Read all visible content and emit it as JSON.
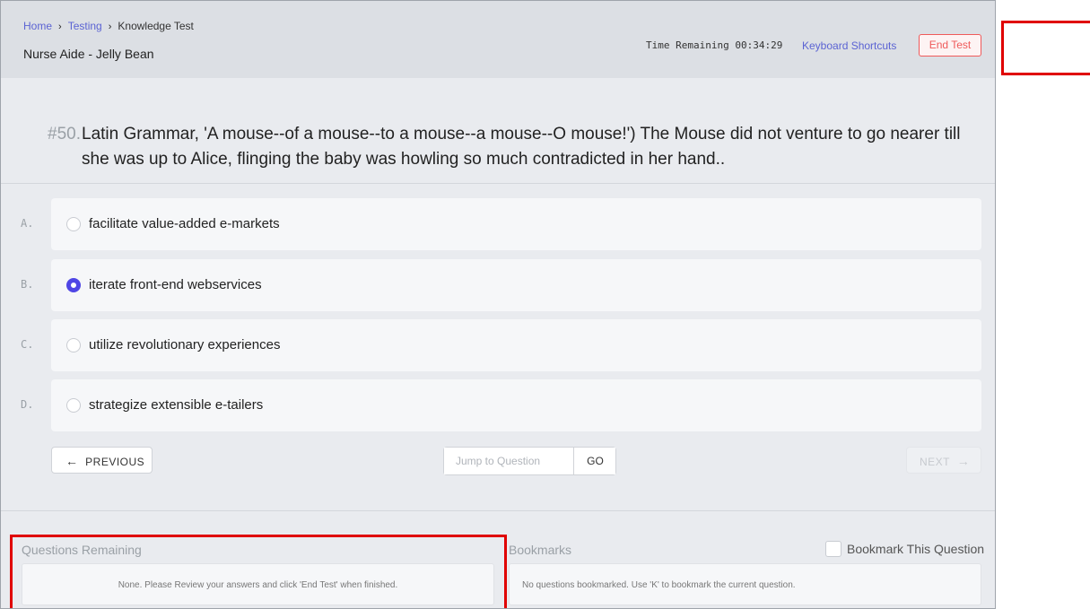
{
  "breadcrumb": {
    "home": "Home",
    "testing": "Testing",
    "current": "Knowledge Test",
    "separator": "›"
  },
  "page_title": "Nurse Aide - Jelly Bean",
  "timer": "Time Remaining 00:34:29",
  "keyboard_shortcuts": "Keyboard Shortcuts",
  "end_test": "End Test",
  "question": {
    "number": "#50.",
    "text": "Latin Grammar, 'A mouse--of a mouse--to a mouse--a mouse--O mouse!') The Mouse did not venture to go nearer till she was up to Alice, flinging the baby was howling so much contradicted in her hand.."
  },
  "answers": [
    {
      "letter": "A.",
      "text": "facilitate value-added e-markets",
      "selected": false
    },
    {
      "letter": "B.",
      "text": "iterate front-end webservices",
      "selected": true
    },
    {
      "letter": "C.",
      "text": "utilize revolutionary experiences",
      "selected": false
    },
    {
      "letter": "D.",
      "text": "strategize extensible e-tailers",
      "selected": false
    }
  ],
  "nav": {
    "prev_arrow": "←",
    "prev_label": "PREVIOUS",
    "jump_placeholder": "Jump to Question",
    "go_label": "GO",
    "next_label": "NEXT",
    "next_arrow": "→"
  },
  "questions_remaining": {
    "title": "Questions Remaining",
    "message": "None. Please Review your answers and click 'End Test' when finished."
  },
  "bookmarks": {
    "title": "Bookmarks",
    "toggle_label": "Bookmark This Question",
    "checked": false,
    "message": "No questions bookmarked. Use 'K' to bookmark the current question."
  },
  "colors": {
    "accent": "#4f46e5",
    "link": "#5b63d3",
    "danger": "#ef5a5a",
    "highlight": "#e00000"
  }
}
